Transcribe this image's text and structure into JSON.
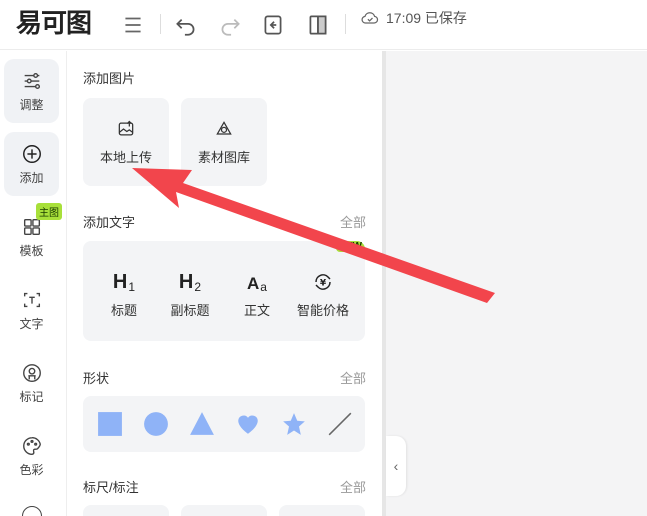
{
  "app": {
    "logo": "易可图"
  },
  "toolbar": {
    "save_time": "17:09 已保存"
  },
  "rail": {
    "items": [
      {
        "label": "调整",
        "icon": "sliders-icon"
      },
      {
        "label": "添加",
        "icon": "plus-circle-icon"
      },
      {
        "label": "模板",
        "icon": "layout-icon",
        "badge": "主图"
      },
      {
        "label": "文字",
        "icon": "text-icon"
      },
      {
        "label": "标记",
        "icon": "stamp-icon"
      },
      {
        "label": "色彩",
        "icon": "palette-icon"
      }
    ]
  },
  "panel": {
    "add_image": {
      "title": "添加图片",
      "items": [
        {
          "label": "本地上传",
          "icon": "upload-image-icon"
        },
        {
          "label": "素材图库",
          "icon": "shapes-icon"
        }
      ]
    },
    "add_text": {
      "title": "添加文字",
      "all": "全部",
      "items": [
        {
          "glyph": "H",
          "sub": "1",
          "label": "标题"
        },
        {
          "glyph": "H",
          "sub": "2",
          "label": "副标题"
        },
        {
          "glyph": "A",
          "sub": "a",
          "label": "正文"
        },
        {
          "glyph": "¥",
          "sub": "",
          "label": "智能价格",
          "badge": "NEW"
        }
      ]
    },
    "shapes": {
      "title": "形状",
      "all": "全部"
    },
    "ruler": {
      "title": "标尺/标注",
      "all": "全部"
    }
  },
  "colors": {
    "shape_fill": "#8fb3f7",
    "accent_red": "#f2454c",
    "badge_green": "#a8e03a"
  }
}
